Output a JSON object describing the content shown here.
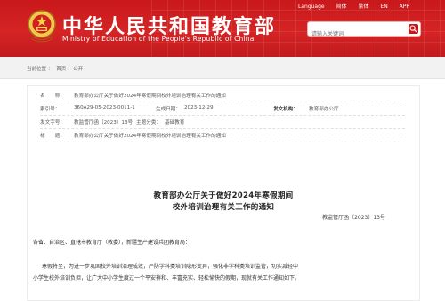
{
  "header": {
    "site_title": "中华人民共和国教育部",
    "site_subtitle": "Ministry of Education of the People's Republic of China",
    "top_links": [
      "Language",
      "简体",
      "繁体",
      "EN",
      "APP"
    ],
    "search_placeholder": "请输入关键词",
    "colors": {
      "brand_red": "#c9181b"
    }
  },
  "breadcrumb": [
    "当前位置",
    "首页",
    "公开"
  ],
  "document": {
    "meta": {
      "index_label": "索引号：",
      "index_value": "360A29-05-2023-0011-1",
      "name_label": "名　　称：",
      "name_value": "教育部办公厅关于做好2024年寒假期间校外培训治理有关工作的通知",
      "issuer_label": "发文机构：",
      "issuer_value": "教育部办公厅",
      "date_label": "生成日期：",
      "date_value": "2023-12-29",
      "docno_label": "发文字号：",
      "docno_value": "教监管厅函〔2023〕13号",
      "topic_label": "主题分类：",
      "topic_value": "基础教育",
      "title_label": "标　　题：",
      "title_value": "教育部办公厅关于做好2024年寒假期间校外培训治理有关工作的通知"
    },
    "title_line1": "教育部办公厅关于做好2024年寒假期间",
    "title_line2": "校外培训治理有关工作的通知",
    "doc_number": "教监管厅函〔2023〕13号",
    "addressee": "各省、自治区、直辖市教育厅（教委），新疆生产建设兵团教育局：",
    "paragraph_line1": "寒假将至，为进一步巩固校外培训治理成效，严防学科类培训隐形变异，强化非学科类培训监管，切实减轻中",
    "paragraph_line2": "小学生校外培训负担，让广大中小学生度过一个平安祥和、丰富充实、轻松愉快的假期，现就有关工作通知如下。"
  }
}
